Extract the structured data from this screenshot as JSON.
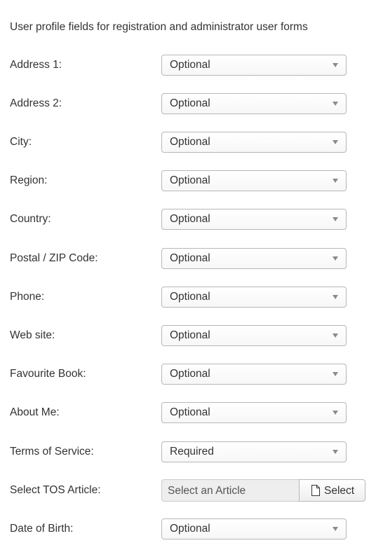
{
  "intro_text": "User profile fields for registration and administrator user forms",
  "fields": [
    {
      "label": "Address 1:",
      "value": "Optional"
    },
    {
      "label": "Address 2:",
      "value": "Optional"
    },
    {
      "label": "City:",
      "value": "Optional"
    },
    {
      "label": "Region:",
      "value": "Optional"
    },
    {
      "label": "Country:",
      "value": "Optional"
    },
    {
      "label": "Postal / ZIP Code:",
      "value": "Optional"
    },
    {
      "label": "Phone:",
      "value": "Optional"
    },
    {
      "label": "Web site:",
      "value": "Optional"
    },
    {
      "label": "Favourite Book:",
      "value": "Optional"
    },
    {
      "label": "About Me:",
      "value": "Optional"
    },
    {
      "label": "Terms of Service:",
      "value": "Required"
    }
  ],
  "tos_article": {
    "label": "Select TOS Article:",
    "placeholder": "Select an Article",
    "button_label": "Select",
    "button_icon": "file-icon"
  },
  "date_of_birth": {
    "label": "Date of Birth:",
    "value": "Optional"
  },
  "dropdown_icon": "caret-down-icon"
}
